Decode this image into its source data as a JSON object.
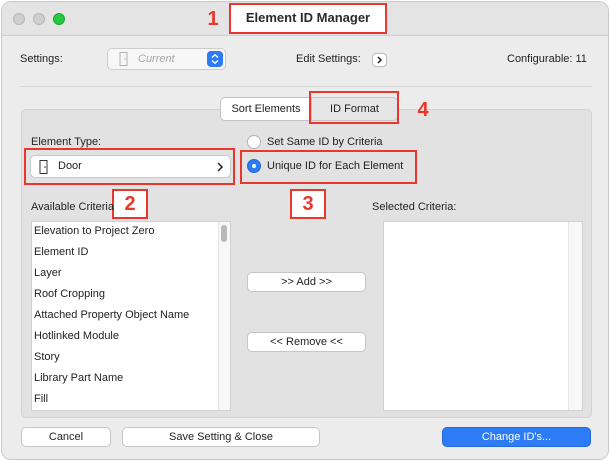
{
  "window": {
    "title": "Element ID Manager"
  },
  "annotations": {
    "badge1": "1",
    "badge2": "2",
    "badge3": "3",
    "badge4": "4",
    "color": "#e8372c"
  },
  "settings_row": {
    "settings_label": "Settings:",
    "settings_value": "Current",
    "edit_settings_label": "Edit Settings:",
    "configurable_label": "Configurable: 11"
  },
  "tabs": [
    {
      "label": "Sort Elements",
      "selected": true
    },
    {
      "label": "ID Format",
      "selected": false
    }
  ],
  "element_type": {
    "label": "Element Type:",
    "value": "Door"
  },
  "options": {
    "same_id": "Set Same ID by Criteria",
    "unique_id": "Unique ID for Each Element",
    "selected": "unique_id"
  },
  "available_criteria": {
    "label": "Available Criteria",
    "items": [
      "Elevation to Project Zero",
      "Element ID",
      "Layer",
      "Roof Cropping",
      "Attached Property Object Name",
      "Hotlinked Module",
      "Story",
      "Library Part Name",
      "Fill"
    ]
  },
  "selected_criteria": {
    "label": "Selected Criteria:",
    "items": []
  },
  "actions": {
    "add": ">> Add >>",
    "remove": "<< Remove <<"
  },
  "footer": {
    "cancel": "Cancel",
    "save": "Save Setting & Close",
    "change": "Change ID's..."
  },
  "colors": {
    "accent": "#2d7cf6",
    "traffic_zoom": "#28c840"
  },
  "icons": {
    "door": "door-icon",
    "chevron": "chevron-right-icon",
    "stepper": "up-down-stepper-icon"
  }
}
